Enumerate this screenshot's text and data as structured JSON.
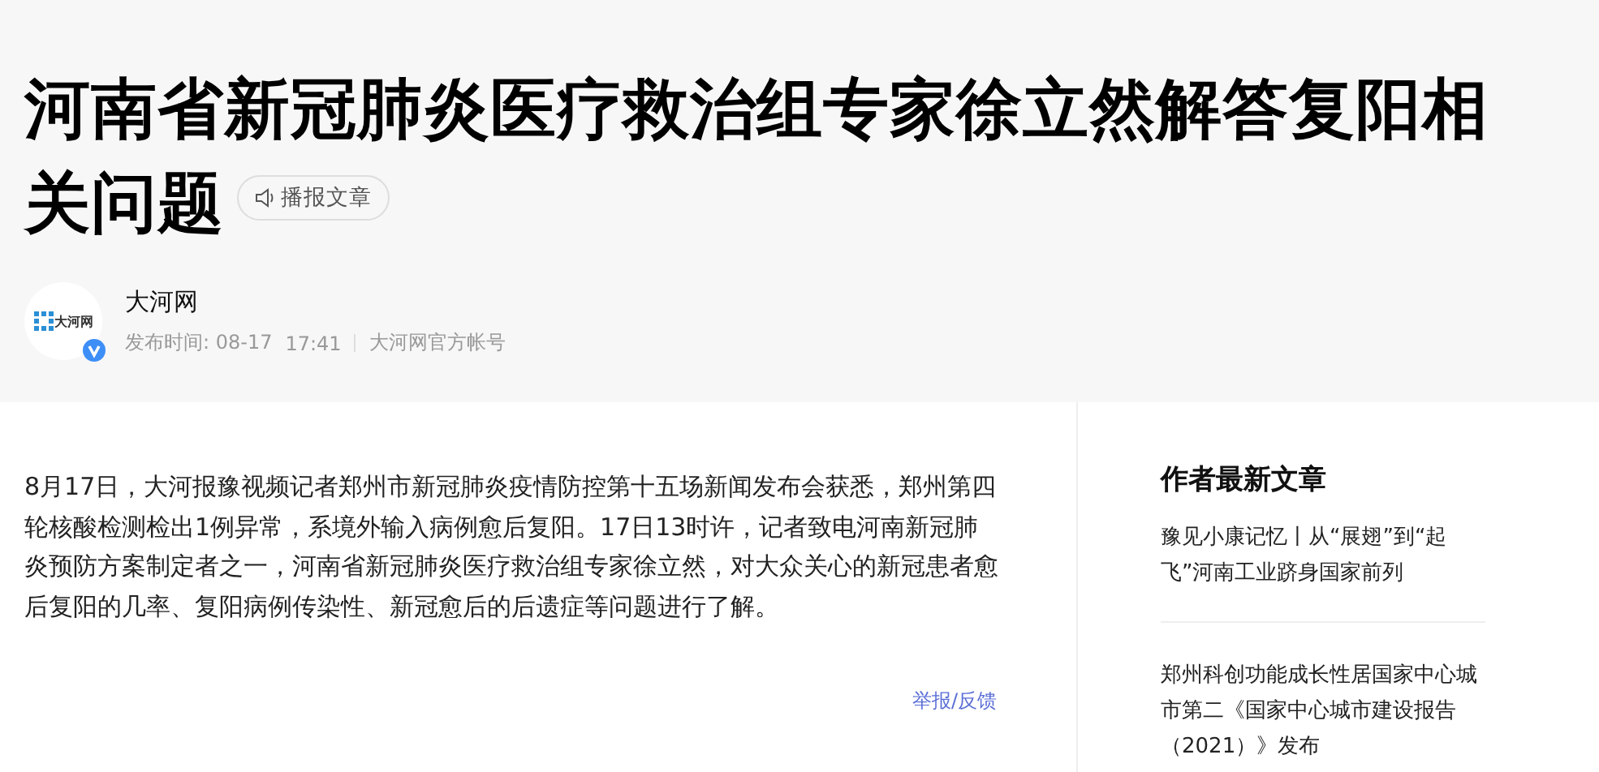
{
  "article": {
    "title": "河南省新冠肺炎医疗救治组专家徐立然解答复阳相关问题",
    "listen_button": "播报文章",
    "author": {
      "name": "大河网",
      "logo_text": "大河网",
      "verified": true,
      "publish_label": "发布时间: 08-17",
      "time": "17:41",
      "account": "大河网官方帐号"
    },
    "body": "8月17日，大河报豫视频记者郑州市新冠肺炎疫情防控第十五场新闻发布会获悉，郑州第四轮核酸检测检出1例异常，系境外输入病例愈后复阳。17日13时许，记者致电河南新冠肺炎预防方案制定者之一，河南省新冠肺炎医疗救治组专家徐立然，对大众关心的新冠患者愈后复阳的几率、复阳病例传染性、新冠愈后的后遗症等问题进行了解。",
    "report_link": "举报/反馈"
  },
  "sidebar": {
    "heading": "作者最新文章",
    "items": [
      {
        "title": "豫见小康记忆丨从“展翅”到“起飞”河南工业跻身国家前列"
      },
      {
        "title": "郑州科创功能成长性居国家中心城市第二《国家中心城市建设报告（2021）》发布"
      }
    ]
  }
}
